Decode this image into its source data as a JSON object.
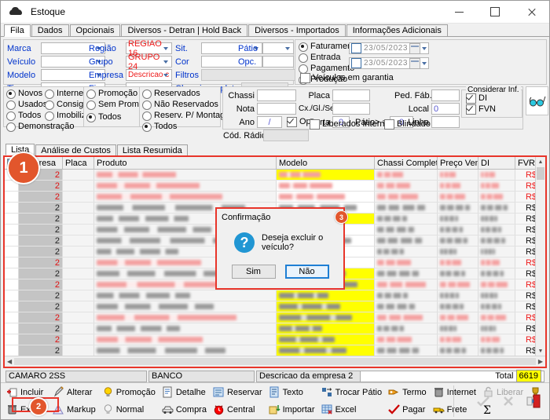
{
  "window": {
    "title": "Estoque",
    "icon": "car-icon",
    "minimize": "minimize-icon",
    "maximize": "maximize-icon",
    "close": "close-icon"
  },
  "tabs": [
    {
      "label": "Fila",
      "active": true
    },
    {
      "label": "Dados",
      "active": false
    },
    {
      "label": "Opcionais",
      "active": false
    },
    {
      "label": "Diversos - Detran | Hold Back",
      "active": false
    },
    {
      "label": "Diversos - Importados",
      "active": false
    },
    {
      "label": "Informações Adicionais",
      "active": false
    }
  ],
  "filters": {
    "col1": [
      {
        "label": "Marca",
        "value": ""
      },
      {
        "label": "Veículo",
        "value": ""
      },
      {
        "label": "Modelo",
        "value": ""
      },
      {
        "label": "Tipo",
        "value": ""
      }
    ],
    "col2": [
      {
        "label": "Região",
        "value": "REGIAO 16",
        "red": true
      },
      {
        "label": "Grupo",
        "value": "GRUPO 24",
        "red": true
      },
      {
        "label": "Empresa",
        "value": "Descricao c",
        "red": true
      },
      {
        "label": "Financ.",
        "value": "",
        "red": false
      }
    ],
    "col3": [
      {
        "label": "Sit.",
        "value": ""
      },
      {
        "label": "Cor",
        "value": ""
      },
      {
        "label": "Filtros",
        "value": ""
      },
      {
        "label": "Chassi completo",
        "value": ""
      }
    ],
    "col4": [
      {
        "label": "Pátio",
        "value": ""
      },
      {
        "label": "Opc.",
        "value": ""
      }
    ],
    "date_radios": [
      {
        "label": "Faturamento",
        "selected": true
      },
      {
        "label": "Entrada",
        "selected": false
      },
      {
        "label": "Pagamento",
        "selected": false
      },
      {
        "label": "Produção",
        "selected": false
      }
    ],
    "date_from": "23/05/2023",
    "date_to": "23/05/2023",
    "warranty_checkbox": {
      "label": "Veículos em garantia",
      "checked": false
    },
    "status_group": [
      {
        "label": "Novos",
        "selected": true
      },
      {
        "label": "Usados",
        "selected": false
      },
      {
        "label": "Todos",
        "selected": false
      },
      {
        "label": "Demonstração",
        "selected": false
      }
    ],
    "origin_group": [
      {
        "label": "Internet",
        "selected": false
      },
      {
        "label": "Consignados",
        "selected": false
      },
      {
        "label": "Imobilizados",
        "selected": false
      }
    ],
    "promo_group": [
      {
        "label": "Promoção",
        "selected": false
      },
      {
        "label": "Sem Promoção",
        "selected": false
      },
      {
        "label": "Todos",
        "selected": true
      }
    ],
    "reserve_group": [
      {
        "label": "Reservados",
        "selected": false
      },
      {
        "label": "Não Reservados",
        "selected": false
      },
      {
        "label": "Reserv. P/ Montagem",
        "selected": false
      },
      {
        "label": "Todos",
        "selected": true
      }
    ],
    "right_fields": [
      {
        "label": "Chassi",
        "value": ""
      },
      {
        "label": "Nota",
        "value": ""
      },
      {
        "label": "Ano",
        "value": "/"
      },
      {
        "label": "Cód. Rádio",
        "value": ""
      },
      {
        "label": "Placa",
        "value": ""
      },
      {
        "label": "Cx./Gl./Seq.",
        "value": ""
      },
      {
        "label": "Ped. Fáb.",
        "value": ""
      },
      {
        "label": "Local",
        "value": "0"
      },
      {
        "label": "Linha",
        "value": ""
      },
      {
        "label": "Porta",
        "value": "0"
      },
      {
        "label": "Pátio> =",
        "value": "0"
      }
    ],
    "opc_checkbox": {
      "label": "Opc.",
      "checked": true
    },
    "liberados_checkbox": {
      "label": "Liberados Internet",
      "checked": false
    },
    "blindado_checkbox": {
      "label": "Blindado",
      "checked": false
    },
    "considerar_inf": {
      "legend": "Considerar Inf.",
      "items": [
        {
          "label": "DI",
          "checked": true
        },
        {
          "label": "FVN",
          "checked": true
        }
      ]
    },
    "glasses_button": "glasses-icon"
  },
  "grid": {
    "tabs": [
      {
        "label": "Lista",
        "active": true
      },
      {
        "label": "Análise de Custos",
        "active": false
      },
      {
        "label": "Lista Resumida",
        "active": false
      }
    ],
    "columns": [
      "",
      "Empresa",
      "Placa",
      "Produto",
      "Modelo",
      "Chassi Completo",
      "Preço Venda",
      "DI",
      "FVR/FV"
    ],
    "rows": [
      {
        "empresa": "2",
        "red": true,
        "modelo_hl": "yellow",
        "selected": false,
        "fvr": "R$"
      },
      {
        "empresa": "2",
        "red": true,
        "modelo_hl": "none",
        "selected": false,
        "fvr": "R$"
      },
      {
        "empresa": "2",
        "red": true,
        "modelo_hl": "none",
        "selected": false,
        "fvr": "R$"
      },
      {
        "empresa": "2",
        "red": false,
        "modelo_hl": "none",
        "selected": false,
        "fvr": "R$"
      },
      {
        "empresa": "2",
        "red": false,
        "modelo_hl": "yellow",
        "selected": false,
        "fvr": "R$"
      },
      {
        "empresa": "2",
        "red": false,
        "modelo_hl": "none",
        "selected": false,
        "fvr": "R$"
      },
      {
        "empresa": "2",
        "red": false,
        "modelo_hl": "none",
        "selected": false,
        "fvr": "R$"
      },
      {
        "empresa": "2",
        "red": false,
        "modelo_hl": "none",
        "selected": false,
        "fvr": "R$"
      },
      {
        "empresa": "2",
        "red": true,
        "modelo_hl": "none",
        "selected": false,
        "fvr": "R$"
      },
      {
        "empresa": "2",
        "red": false,
        "modelo_hl": "yellow",
        "selected": false,
        "fvr": "R$"
      },
      {
        "empresa": "2",
        "red": true,
        "modelo_hl": "yellow",
        "selected": false,
        "fvr": "R$"
      },
      {
        "empresa": "2",
        "red": false,
        "modelo_hl": "yellow",
        "selected": false,
        "fvr": "R$"
      },
      {
        "empresa": "2",
        "red": false,
        "modelo_hl": "yellow",
        "selected": false,
        "fvr": "R$"
      },
      {
        "empresa": "2",
        "red": true,
        "modelo_hl": "yellow",
        "selected": false,
        "fvr": "R$"
      },
      {
        "empresa": "2",
        "red": false,
        "modelo_hl": "yellow",
        "selected": false,
        "fvr": "R$"
      },
      {
        "empresa": "2",
        "red": true,
        "modelo_hl": "yellow",
        "selected": false,
        "fvr": "R$"
      },
      {
        "empresa": "2",
        "red": false,
        "modelo_hl": "yellow",
        "selected": false,
        "fvr": "R$"
      },
      {
        "empresa": "2",
        "red": true,
        "modelo_hl": "yellow",
        "selected": false,
        "fvr": "R$"
      },
      {
        "empresa": "2",
        "red": false,
        "modelo_hl": "yellow",
        "selected": true,
        "fvr": "R$"
      }
    ]
  },
  "status": {
    "vehicle": "CAMARO 2SS",
    "bank": "BANCO",
    "company": "Descricao da empresa 2",
    "total_label": "Total",
    "total_value": "6619"
  },
  "toolbar": {
    "items": [
      {
        "label": "Incluir",
        "icon": "add-icon",
        "disabled": false
      },
      {
        "label": "Excluir",
        "icon": "trash-icon",
        "disabled": false
      },
      {
        "label": "Alterar",
        "icon": "edit-icon",
        "disabled": false
      },
      {
        "label": "Markup",
        "icon": "chart-icon",
        "disabled": false
      },
      {
        "label": "Promoção",
        "icon": "bulb-icon",
        "disabled": false
      },
      {
        "label": "Normal",
        "icon": "bulb-off-icon",
        "disabled": false
      },
      {
        "label": "Detalhe",
        "icon": "detail-icon",
        "disabled": false
      },
      {
        "label": "Compra",
        "icon": "car-buy-icon",
        "disabled": false
      },
      {
        "label": "Reservar",
        "icon": "reserve-icon",
        "disabled": false
      },
      {
        "label": "Central",
        "icon": "clock-icon",
        "disabled": false
      },
      {
        "label": "Texto",
        "icon": "text-icon",
        "disabled": false
      },
      {
        "label": "Importar",
        "icon": "import-icon",
        "disabled": false
      },
      {
        "label": "Trocar Pátio",
        "icon": "swap-icon",
        "disabled": false
      },
      {
        "label": "Excel",
        "icon": "excel-icon",
        "disabled": false
      },
      {
        "label": "Termo",
        "icon": "hand-icon",
        "disabled": false
      },
      {
        "label": "Pagar",
        "icon": "check-icon",
        "disabled": false
      },
      {
        "label": "Internet",
        "icon": "trash2-icon",
        "disabled": false
      },
      {
        "label": "Frete",
        "icon": "truck-icon",
        "disabled": false
      },
      {
        "label": "Liberar",
        "icon": "lock-icon",
        "disabled": true
      },
      {
        "label": "",
        "icon": "sigma-icon",
        "disabled": false
      },
      {
        "label": "",
        "icon": "trophy-icon",
        "disabled": false
      }
    ],
    "right": [
      {
        "icon": "confirm-icon",
        "disabled": true
      },
      {
        "icon": "cancel-icon",
        "disabled": true
      },
      {
        "icon": "exit-icon",
        "disabled": false
      }
    ]
  },
  "dialog": {
    "title": "Confirmação",
    "message": "Deseja excluir o veículo?",
    "icon": "question-icon",
    "yes": "Sim",
    "no": "Não"
  },
  "annotations": [
    {
      "id": "1",
      "target": "grid-region"
    },
    {
      "id": "2",
      "target": "excluir-button"
    },
    {
      "id": "3",
      "target": "confirmation-dialog"
    }
  ],
  "colors": {
    "accent_red": "#e8352a",
    "badge": "#e2562c",
    "highlight_yellow": "#ffff00",
    "selection_blue": "#0a7ae0",
    "label_blue": "#0033cc",
    "value_red": "#ee1c1c"
  }
}
